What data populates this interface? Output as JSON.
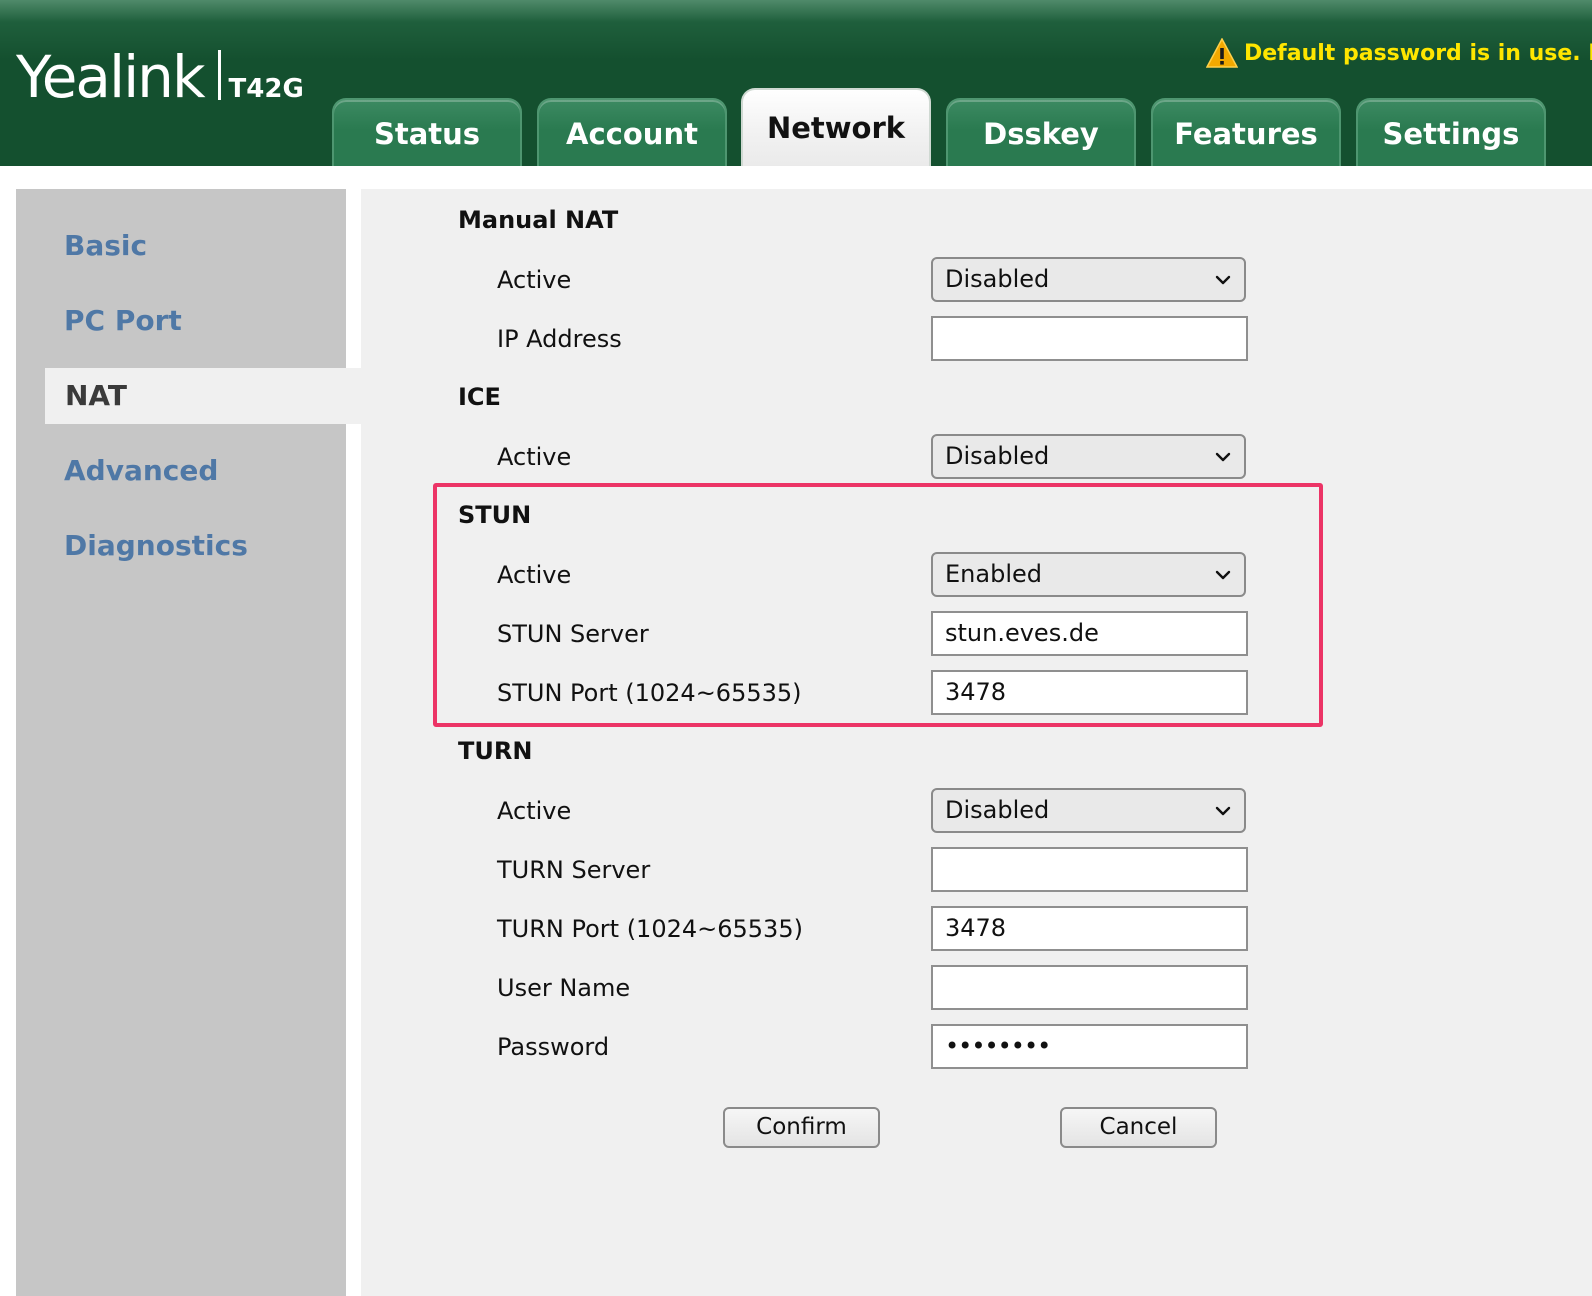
{
  "header": {
    "brand": "Yealink",
    "model": "T42G",
    "warning": "Default password is in use. Pl"
  },
  "tabs": [
    {
      "label": "Status",
      "active": false
    },
    {
      "label": "Account",
      "active": false
    },
    {
      "label": "Network",
      "active": true
    },
    {
      "label": "Dsskey",
      "active": false
    },
    {
      "label": "Features",
      "active": false
    },
    {
      "label": "Settings",
      "active": false
    }
  ],
  "sidebar": {
    "items": [
      {
        "label": "Basic",
        "active": false
      },
      {
        "label": "PC Port",
        "active": false
      },
      {
        "label": "NAT",
        "active": true
      },
      {
        "label": "Advanced",
        "active": false
      },
      {
        "label": "Diagnostics",
        "active": false
      }
    ]
  },
  "manual_nat": {
    "title": "Manual NAT",
    "active_label": "Active",
    "active_value": "Disabled",
    "ip_label": "IP Address",
    "ip_value": ""
  },
  "ice": {
    "title": "ICE",
    "active_label": "Active",
    "active_value": "Disabled"
  },
  "stun": {
    "title": "STUN",
    "active_label": "Active",
    "active_value": "Enabled",
    "server_label": "STUN Server",
    "server_value": "stun.eves.de",
    "port_label": "STUN Port (1024~65535)",
    "port_value": "3478"
  },
  "turn": {
    "title": "TURN",
    "active_label": "Active",
    "active_value": "Disabled",
    "server_label": "TURN Server",
    "server_value": "",
    "port_label": "TURN Port (1024~65535)",
    "port_value": "3478",
    "username_label": "User Name",
    "username_value": "",
    "password_label": "Password",
    "password_value": "••••••••"
  },
  "actions": {
    "confirm": "Confirm",
    "cancel": "Cancel"
  },
  "colors": {
    "header_green": "#14502f",
    "warning_yellow": "#ffe600",
    "sidebar_link": "#4f78a6",
    "highlight_border": "#ec3466"
  }
}
